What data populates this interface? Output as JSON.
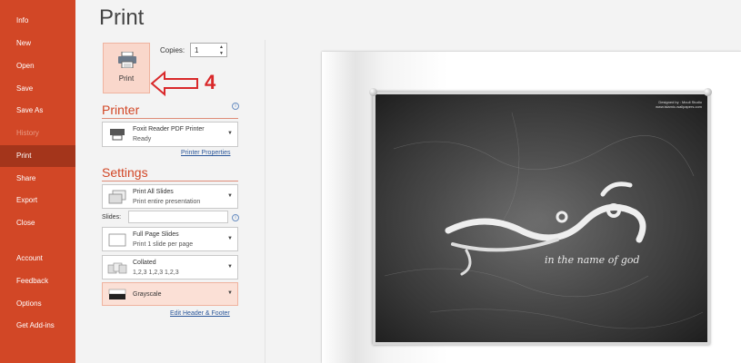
{
  "sidebar": {
    "items": [
      {
        "label": "Info",
        "state": "normal"
      },
      {
        "label": "New",
        "state": "normal"
      },
      {
        "label": "Open",
        "state": "normal"
      },
      {
        "label": "Save",
        "state": "normal"
      },
      {
        "label": "Save As",
        "state": "normal"
      },
      {
        "label": "History",
        "state": "disabled"
      },
      {
        "label": "Print",
        "state": "active"
      },
      {
        "label": "Share",
        "state": "normal"
      },
      {
        "label": "Export",
        "state": "normal"
      },
      {
        "label": "Close",
        "state": "normal"
      },
      {
        "label": "Account",
        "state": "normal"
      },
      {
        "label": "Feedback",
        "state": "normal"
      },
      {
        "label": "Options",
        "state": "normal"
      },
      {
        "label": "Get Add-ins",
        "state": "normal"
      }
    ]
  },
  "print": {
    "title": "Print",
    "button_label": "Print",
    "copies_label": "Copies:",
    "copies_value": "1",
    "annotation": "4"
  },
  "printer": {
    "section_title": "Printer",
    "name": "Foxit Reader PDF Printer",
    "status": "Ready",
    "properties_link": "Printer Properties"
  },
  "settings": {
    "section_title": "Settings",
    "slides_range": {
      "main": "Print All Slides",
      "sub": "Print entire presentation"
    },
    "slides_label": "Slides:",
    "slides_value": "",
    "layout": {
      "main": "Full Page Slides",
      "sub": "Print 1 slide per page"
    },
    "collation": {
      "main": "Collated",
      "sub": "1,2,3    1,2,3    1,2,3"
    },
    "color": {
      "main": "Grayscale"
    },
    "header_footer_link": "Edit Header & Footer"
  },
  "preview": {
    "caption": "in the name of god",
    "credit_line1": "Designed by : Mouli Studio",
    "credit_line2": "www.islamic-wallpapers.com"
  },
  "colors": {
    "accent": "#d24726",
    "sidebar_active": "#a4351b",
    "annotation": "#d9282a",
    "link": "#2b579a"
  }
}
